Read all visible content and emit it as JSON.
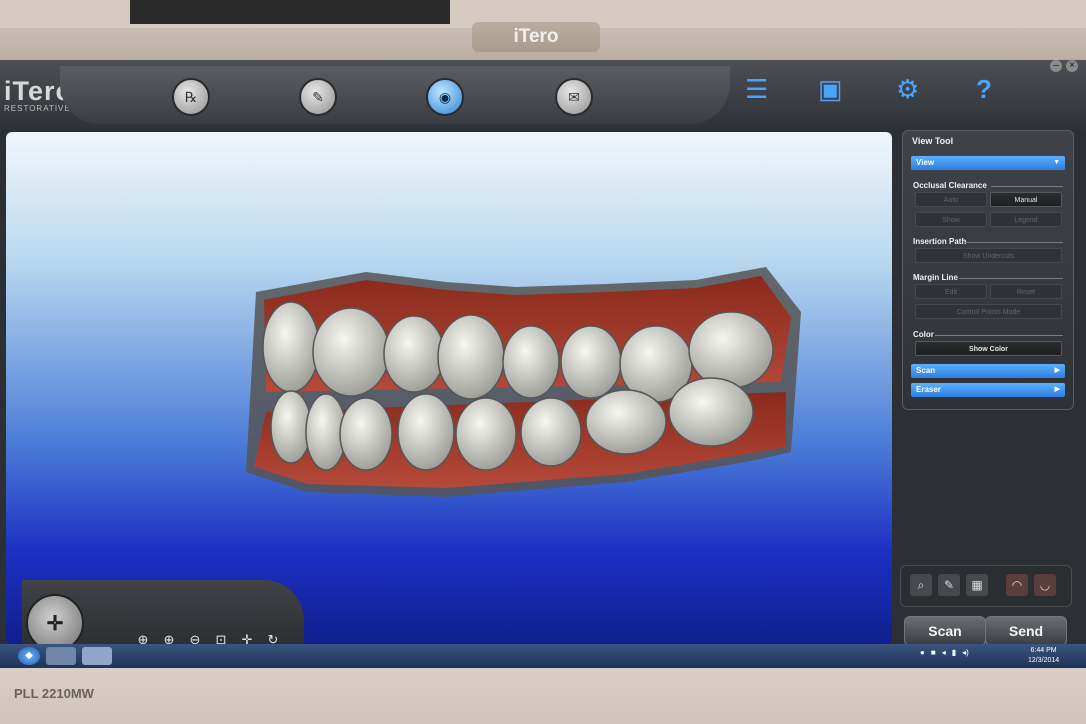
{
  "monitor": {
    "brand": "iTero",
    "model": "PLL 2210MW"
  },
  "app": {
    "logo": "iTero",
    "logo_sub": "RESTORATIVE"
  },
  "toolbar": {
    "nav_buttons": [
      {
        "icon": "rx-icon"
      },
      {
        "icon": "scan-wand-icon"
      },
      {
        "icon": "eye-icon"
      },
      {
        "icon": "send-mail-icon"
      }
    ],
    "tools": [
      {
        "icon": "document-list-icon",
        "glyph": "☰"
      },
      {
        "icon": "save-icon",
        "glyph": "▣"
      },
      {
        "icon": "gear-icon",
        "glyph": "⚙"
      },
      {
        "icon": "help-icon",
        "glyph": "?"
      }
    ]
  },
  "view_tool": {
    "title": "View Tool",
    "dropdown": "View",
    "occlusal_clearance": {
      "label": "Occlusal Clearance",
      "auto": "Auto",
      "manual": "Manual",
      "show": "Show",
      "legend": "Legend"
    },
    "insertion_path": {
      "label": "Insertion Path",
      "show_undercuts": "Show Undercuts"
    },
    "margin_line": {
      "label": "Margin Line",
      "edit": "Edit",
      "reset": "Reset",
      "control_points": "Control Points Mode"
    },
    "color": {
      "label": "Color",
      "show_color": "Show Color"
    },
    "scan": "Scan",
    "eraser": "Eraser"
  },
  "actions": {
    "scan": "Scan",
    "send": "Send"
  },
  "taskbar": {
    "time": "6:44 PM",
    "date": "12/3/2014"
  }
}
